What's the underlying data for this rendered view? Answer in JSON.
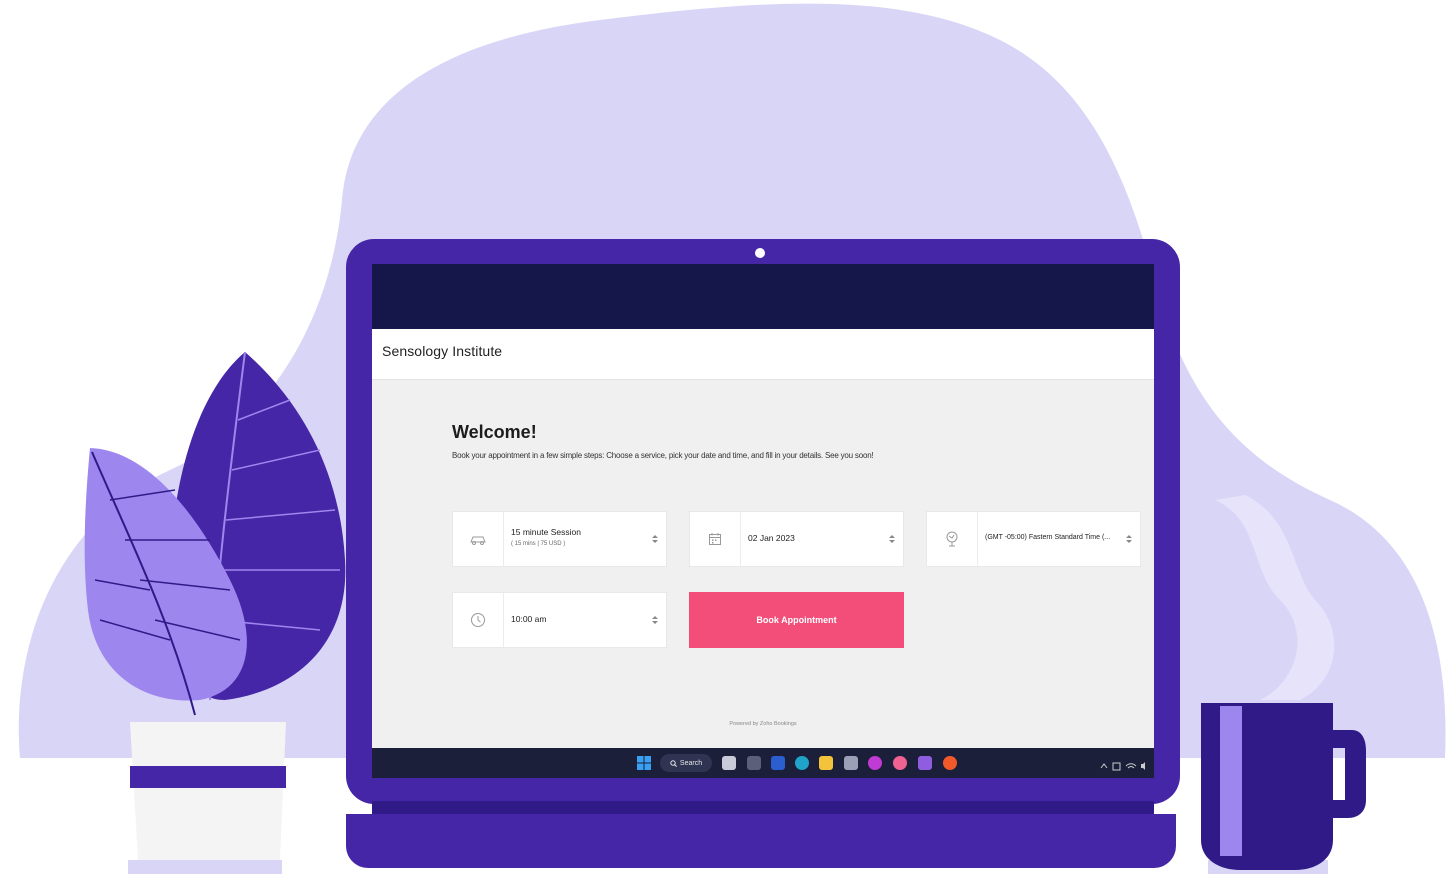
{
  "site": {
    "name": "Sensology Institute"
  },
  "welcome": {
    "title": "Welcome!",
    "description": "Book your appointment in a few simple steps: Choose a service, pick your date and time, and fill in your details. See you soon!"
  },
  "fields": {
    "service": {
      "label": "15 minute Session",
      "detail": "( 15 mins | 75 USD )",
      "icon": "service-icon"
    },
    "date": {
      "value": "02 Jan 2023",
      "icon": "calendar-icon"
    },
    "timezone": {
      "value": "(GMT -05:00) Fastern Standard Time (...",
      "icon": "timezone-icon"
    },
    "time": {
      "value": "10:00 am",
      "icon": "clock-icon"
    }
  },
  "actions": {
    "book_label": "Book Appointment"
  },
  "footer": {
    "powered_by": "Powered by Zoho Bookings"
  },
  "taskbar": {
    "search_label": "Search"
  },
  "colors": {
    "lavender_blob": "#d9d5f7",
    "laptop": "#4526a6",
    "screen_bar": "#15164a",
    "book_button": "#f24e79",
    "leaf_dark": "#4526a6",
    "leaf_light": "#9e86ef",
    "mug": "#2f1a87"
  }
}
